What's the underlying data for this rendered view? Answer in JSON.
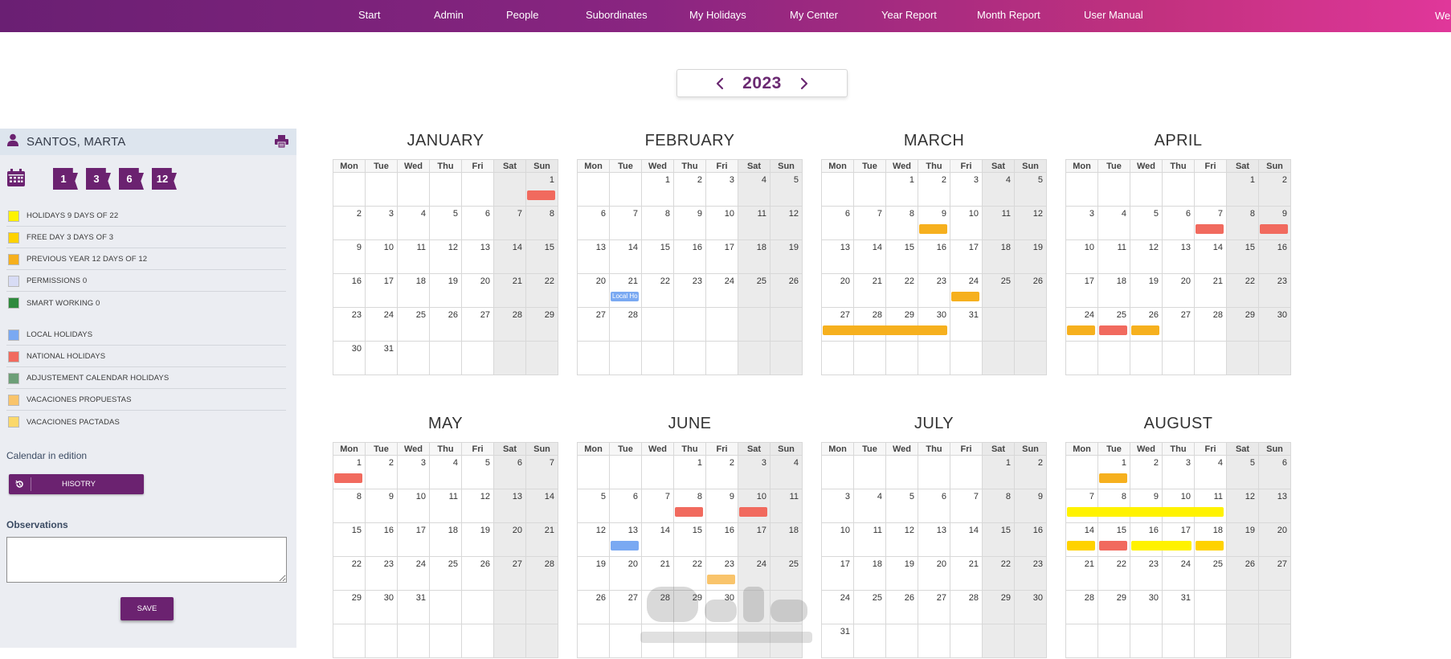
{
  "topnav": {
    "items": [
      "Start",
      "Admin",
      "People",
      "Subordinates",
      "My Holidays",
      "My Center",
      "Year Report",
      "Month Report",
      "User Manual"
    ],
    "welcome": "Wel"
  },
  "year_selector": {
    "year": "2023",
    "prev_icon": "chevron-left-icon",
    "next_icon": "chevron-right-icon"
  },
  "sidebar": {
    "user_name": "SANTOS, MARTA",
    "user_icon": "user-icon",
    "print_icon": "print-icon",
    "calendar_icon": "calendar-icon",
    "badges": [
      "1",
      "3",
      "6",
      "12"
    ],
    "legend": [
      {
        "label": "HOLIDAYS 9 DAYS OF 22",
        "color": "#fff200"
      },
      {
        "label": "FREE DAY 3 DAYS OF 3",
        "color": "#ffd200"
      },
      {
        "label": "PREVIOUS YEAR 12 DAYS OF 12",
        "color": "#f6b01e"
      },
      {
        "label": "PERMISSIONS 0",
        "color": "#d8dcf5"
      },
      {
        "label": "SMART WORKING 0",
        "color": "#2f8a3e"
      },
      {
        "label": "LOCAL HOLIDAYS",
        "color": "#7aa9f2"
      },
      {
        "label": "NATIONAL HOLIDAYS",
        "color": "#f16a5e"
      },
      {
        "label": "ADJUSTEMENT CALENDAR HOLIDAYS",
        "color": "#6d9f78"
      },
      {
        "label": "VACACIONES PROPUESTAS",
        "color": "#f9c46b"
      },
      {
        "label": "VACACIONES PACTADAS",
        "color": "#fbd86a"
      }
    ],
    "calendar_in_edition": "Calendar in edition",
    "history_button": "HISOTRY",
    "history_icon": "history-icon",
    "observations_label": "Observations",
    "observations_value": "",
    "save_button": "SAVE"
  },
  "weekdays": [
    "Mon",
    "Tue",
    "Wed",
    "Thu",
    "Fri",
    "Sat",
    "Sun"
  ],
  "colors": {
    "national": "#f16a5e",
    "previous_year": "#f6b01e",
    "free_day": "#ffd200",
    "holiday": "#fff200",
    "local": "#7aa9f2",
    "proposed": "#f9c46b"
  },
  "months": [
    {
      "name": "JANUARY",
      "offset": 6,
      "days": 31,
      "events": [
        {
          "day": 1,
          "span": 1,
          "type": "national"
        }
      ]
    },
    {
      "name": "FEBRUARY",
      "offset": 2,
      "days": 28,
      "events": [
        {
          "day": 21,
          "span": 1,
          "type": "local",
          "label": "Local Ho"
        }
      ]
    },
    {
      "name": "MARCH",
      "offset": 2,
      "days": 31,
      "events": [
        {
          "day": 9,
          "span": 1,
          "type": "previous_year"
        },
        {
          "day": 24,
          "span": 1,
          "type": "previous_year"
        },
        {
          "day": 27,
          "span": 4,
          "type": "previous_year"
        }
      ]
    },
    {
      "name": "APRIL",
      "offset": 5,
      "days": 30,
      "events": [
        {
          "day": 7,
          "span": 1,
          "type": "national"
        },
        {
          "day": 9,
          "span": 1,
          "type": "national"
        },
        {
          "day": 24,
          "span": 1,
          "type": "previous_year"
        },
        {
          "day": 25,
          "span": 1,
          "type": "national"
        },
        {
          "day": 26,
          "span": 1,
          "type": "previous_year"
        }
      ]
    },
    {
      "name": "MAY",
      "offset": 0,
      "days": 31,
      "events": [
        {
          "day": 1,
          "span": 1,
          "type": "national"
        }
      ]
    },
    {
      "name": "JUNE",
      "offset": 3,
      "days": 30,
      "events": [
        {
          "day": 8,
          "span": 1,
          "type": "national"
        },
        {
          "day": 10,
          "span": 1,
          "type": "national"
        },
        {
          "day": 13,
          "span": 1,
          "type": "local"
        },
        {
          "day": 23,
          "span": 1,
          "type": "proposed"
        }
      ]
    },
    {
      "name": "JULY",
      "offset": 5,
      "days": 31,
      "events": []
    },
    {
      "name": "AUGUST",
      "offset": 1,
      "days": 31,
      "events": [
        {
          "day": 1,
          "span": 1,
          "type": "previous_year"
        },
        {
          "day": 7,
          "span": 5,
          "type": "holiday"
        },
        {
          "day": 14,
          "span": 1,
          "type": "free_day"
        },
        {
          "day": 15,
          "span": 1,
          "type": "national"
        },
        {
          "day": 16,
          "span": 2,
          "type": "holiday"
        },
        {
          "day": 18,
          "span": 1,
          "type": "free_day"
        }
      ]
    }
  ]
}
